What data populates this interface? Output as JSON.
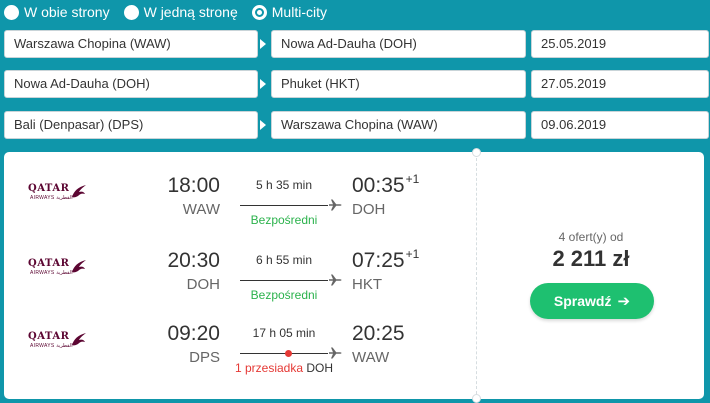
{
  "trip_type": {
    "options": [
      {
        "label": "W obie strony",
        "selected": false
      },
      {
        "label": "W jedną stronę",
        "selected": false
      },
      {
        "label": "Multi-city",
        "selected": true
      }
    ]
  },
  "search_legs": [
    {
      "from": "Warszawa Chopina (WAW)",
      "to": "Nowa Ad-Dauha (DOH)",
      "date": "25.05.2019"
    },
    {
      "from": "Nowa Ad-Dauha (DOH)",
      "to": "Phuket (HKT)",
      "date": "27.05.2019"
    },
    {
      "from": "Bali (Denpasar) (DPS)",
      "to": "Warszawa Chopina (WAW)",
      "date": "09.06.2019"
    }
  ],
  "result": {
    "airline_logo": {
      "icon": "qatar-airways-logo",
      "word": "QATAR",
      "sub": "AIRWAYS القطرية",
      "color": "#5c0632"
    },
    "legs": [
      {
        "dep_time": "18:00",
        "dep_code": "WAW",
        "duration": "5 h 35 min",
        "status": "Bezpośredni",
        "stops_label": "",
        "via": "",
        "arr_time": "00:35",
        "day_offset": "+1",
        "arr_code": "DOH"
      },
      {
        "dep_time": "20:30",
        "dep_code": "DOH",
        "duration": "6 h 55 min",
        "status": "Bezpośredni",
        "stops_label": "",
        "via": "",
        "arr_time": "07:25",
        "day_offset": "+1",
        "arr_code": "HKT"
      },
      {
        "dep_time": "09:20",
        "dep_code": "DPS",
        "duration": "17 h 05 min",
        "status": "",
        "stops_label": "1 przesiadka",
        "via": "DOH",
        "arr_time": "20:25",
        "day_offset": "",
        "arr_code": "WAW"
      }
    ],
    "offers_label": "4 ofert(y) od",
    "price": "2 211 zł",
    "cta_label": "Sprawdź",
    "cta_icon": "arrow-right-icon"
  },
  "colors": {
    "background": "#0f96aa",
    "direct": "#2bb24c",
    "stops": "#e53935",
    "cta": "#1ec070"
  }
}
